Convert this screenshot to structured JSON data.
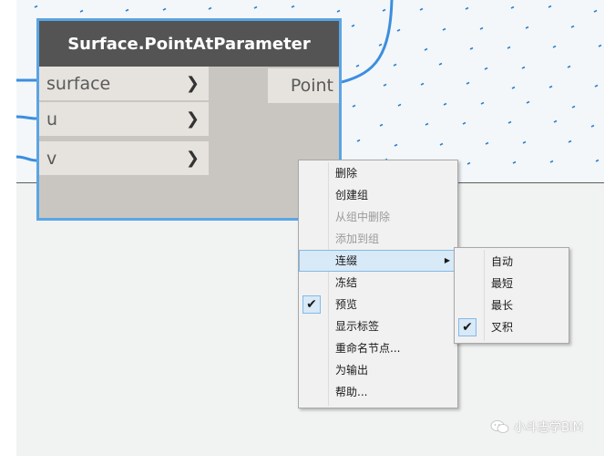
{
  "node": {
    "title": "Surface.PointAtParameter",
    "inputs": [
      {
        "label": "surface"
      },
      {
        "label": "u"
      },
      {
        "label": "v"
      }
    ],
    "output": {
      "label": "Point"
    }
  },
  "context_menu": {
    "items": [
      {
        "label": "删除",
        "enabled": true,
        "checked": false
      },
      {
        "label": "创建组",
        "enabled": true,
        "checked": false
      },
      {
        "label": "从组中删除",
        "enabled": false,
        "checked": false
      },
      {
        "label": "添加到组",
        "enabled": false,
        "checked": false
      },
      {
        "label": "连缀",
        "enabled": true,
        "checked": false,
        "has_submenu": true,
        "highlighted": true
      },
      {
        "label": "冻结",
        "enabled": true,
        "checked": false
      },
      {
        "label": "预览",
        "enabled": true,
        "checked": true
      },
      {
        "label": "显示标签",
        "enabled": true,
        "checked": false
      },
      {
        "label": "重命名节点...",
        "enabled": true,
        "checked": false
      },
      {
        "label": "为输出",
        "enabled": true,
        "checked": false
      },
      {
        "label": "帮助...",
        "enabled": true,
        "checked": false
      }
    ]
  },
  "lacing_submenu": {
    "items": [
      {
        "label": "自动",
        "checked": false
      },
      {
        "label": "最短",
        "checked": false
      },
      {
        "label": "最长",
        "checked": false
      },
      {
        "label": "叉积",
        "checked": true
      }
    ]
  },
  "watermark": {
    "text": "小斗志学BIM"
  },
  "colors": {
    "node_border": "#5aa5e4",
    "node_header": "#545454",
    "wire": "#3b8ee0",
    "point_marks": "#2f7fd0",
    "menu_highlight": "#d8e9f7"
  }
}
